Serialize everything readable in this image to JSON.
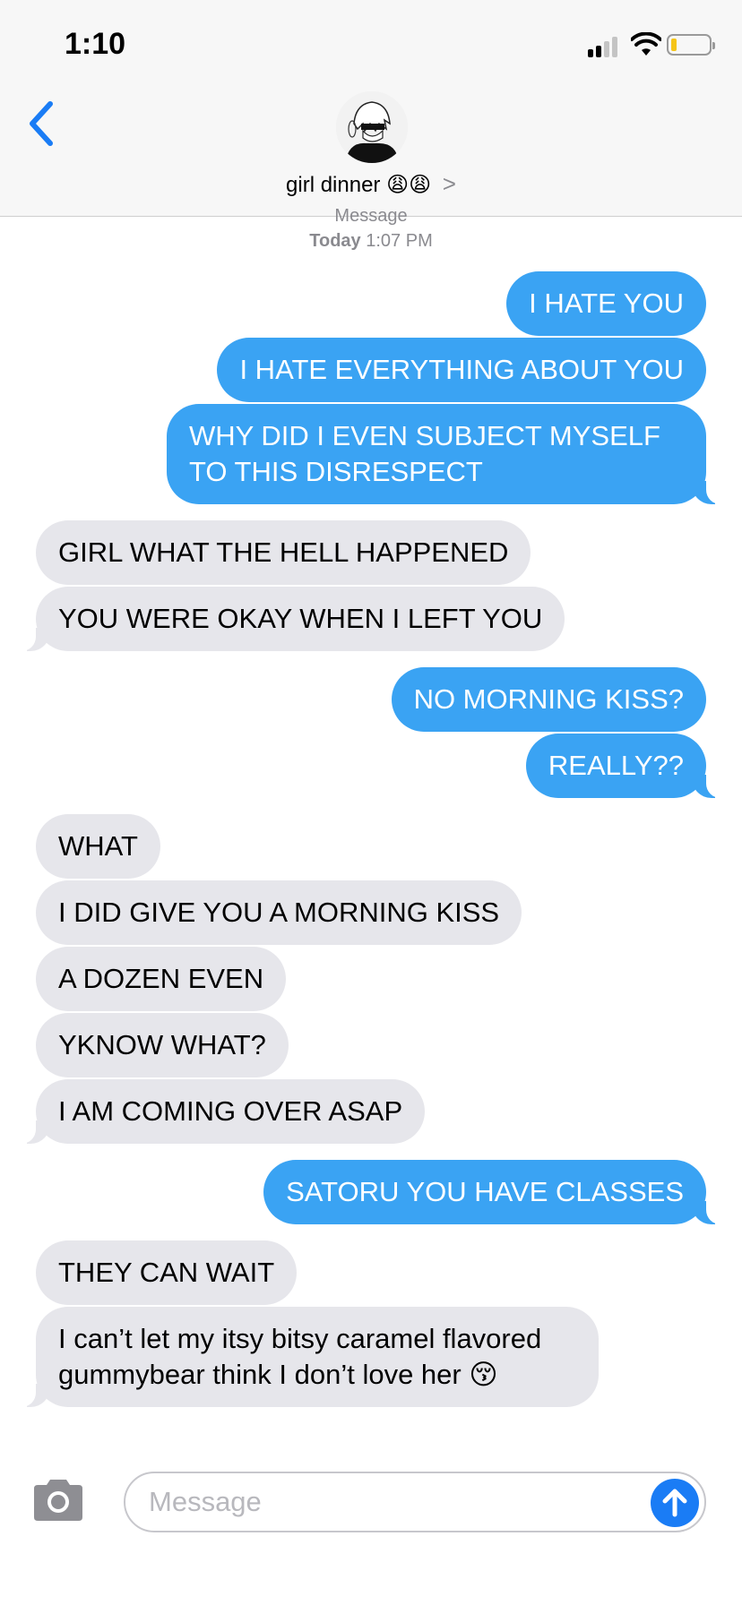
{
  "status_bar": {
    "time": "1:10",
    "battery_level": 0.15,
    "battery_color": "#f5c518"
  },
  "header": {
    "back_icon": "chevron-left-icon",
    "contact_name": "girl dinner",
    "contact_emojis": "😩😩",
    "disclosure": ">"
  },
  "thread": {
    "service_label": "Message",
    "timestamp_day": "Today",
    "timestamp_time": "1:07 PM",
    "messages": [
      {
        "from": "me",
        "text": "I HATE YOU"
      },
      {
        "from": "me",
        "text": "I HATE EVERYTHING ABOUT YOU"
      },
      {
        "from": "me",
        "text": "WHY DID I EVEN SUBJECT MYSELF TO THIS DISRESPECT"
      },
      {
        "from": "them",
        "text": "GIRL WHAT THE HELL HAPPENED"
      },
      {
        "from": "them",
        "text": "YOU WERE OKAY WHEN I LEFT YOU"
      },
      {
        "from": "me",
        "text": "NO MORNING KISS?"
      },
      {
        "from": "me",
        "text": "REALLY??"
      },
      {
        "from": "them",
        "text": "WHAT"
      },
      {
        "from": "them",
        "text": "I DID GIVE YOU A MORNING KISS"
      },
      {
        "from": "them",
        "text": "A DOZEN EVEN"
      },
      {
        "from": "them",
        "text": "YKNOW WHAT?"
      },
      {
        "from": "them",
        "text": "I AM COMING OVER ASAP"
      },
      {
        "from": "me",
        "text": "SATORU YOU HAVE CLASSES"
      },
      {
        "from": "them",
        "text": "THEY CAN WAIT"
      },
      {
        "from": "them",
        "text": "I can’t let my itsy bitsy caramel flavored gummybear think I don’t love her 😚"
      }
    ]
  },
  "composer": {
    "camera_icon": "camera-icon",
    "placeholder": "Message",
    "send_icon": "arrow-up-icon"
  },
  "colors": {
    "outgoing_bubble": "#3aa3f3",
    "incoming_bubble": "#e6e6eb",
    "accent": "#1a7cf5"
  }
}
